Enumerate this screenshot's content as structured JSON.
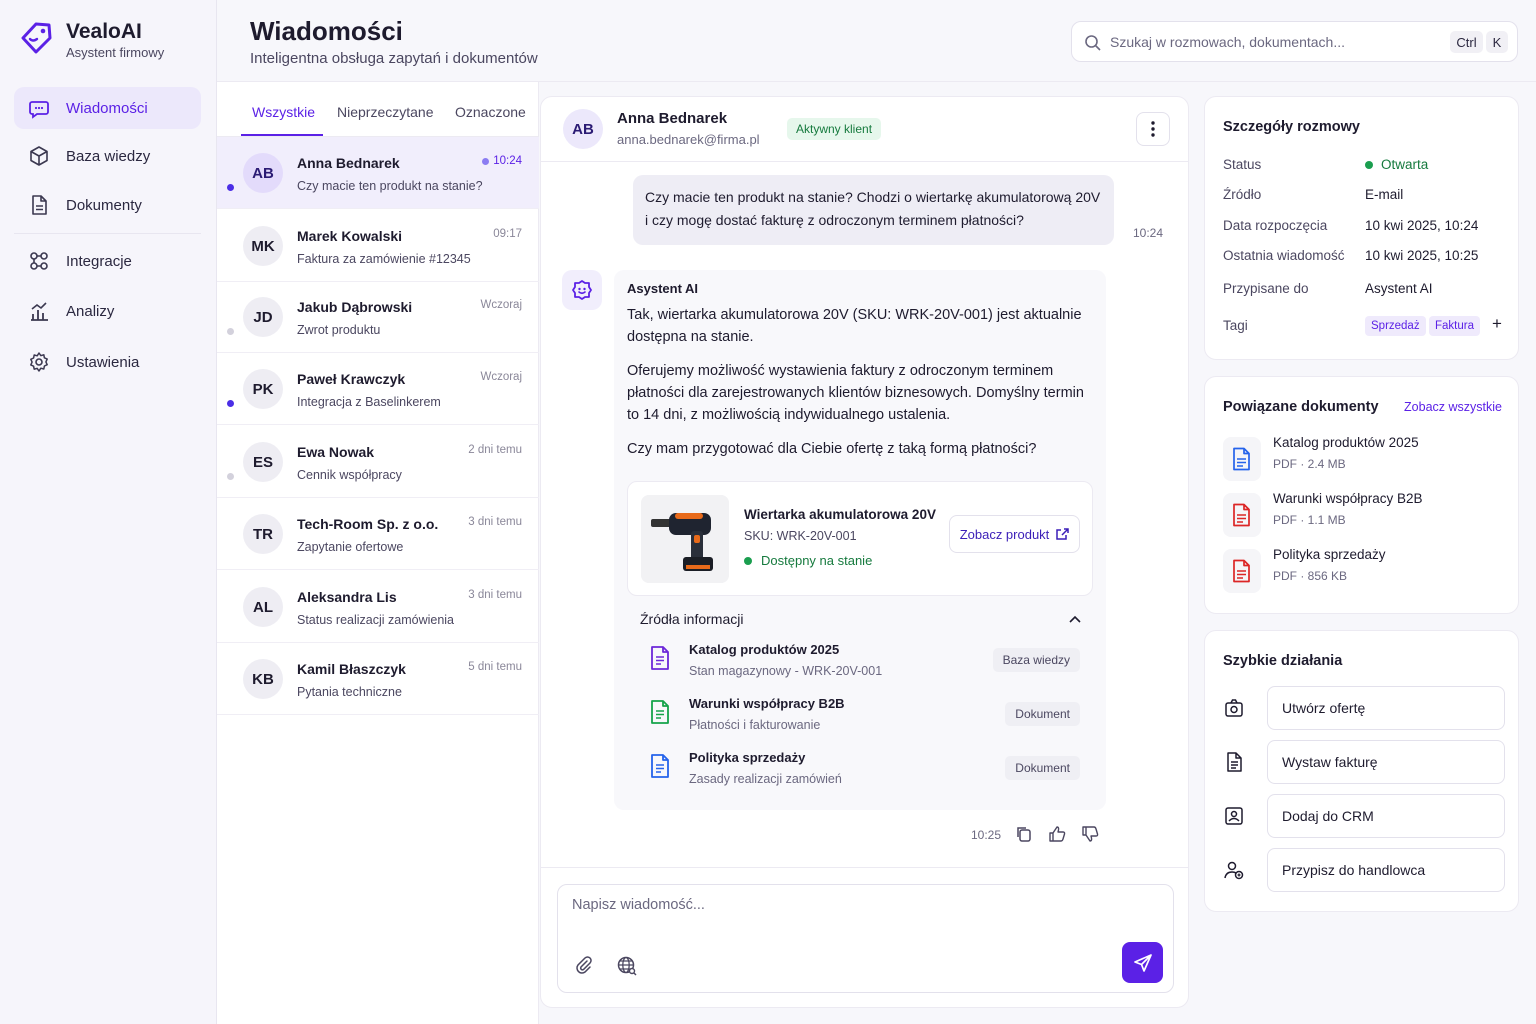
{
  "app": {
    "name": "VealoAI",
    "subtitle": "Asystent firmowy",
    "accent": "#5b21e6"
  },
  "sidebar": {
    "items": [
      {
        "label": "Wiadomości",
        "icon": "chat-icon",
        "active": true
      },
      {
        "label": "Baza wiedzy",
        "icon": "cube-icon"
      },
      {
        "label": "Dokumenty",
        "icon": "document-icon"
      },
      {
        "label": "Integracje",
        "icon": "integrations-icon"
      },
      {
        "label": "Analizy",
        "icon": "analytics-icon"
      },
      {
        "label": "Ustawienia",
        "icon": "gear-icon"
      }
    ]
  },
  "header": {
    "title": "Wiadomości",
    "subtitle": "Inteligentna obsługa zapytań i dokumentów",
    "search_placeholder": "Szukaj w rozmowach, dokumentach...",
    "shortcut_ctrl": "Ctrl",
    "shortcut_key": "K"
  },
  "tabs": [
    "Wszystkie",
    "Nieprzeczytane",
    "Oznaczone"
  ],
  "conversations": [
    {
      "initials": "AB",
      "name": "Anna Bednarek",
      "preview": "Czy macie ten produkt na stanie?",
      "time": "10:24",
      "unread": true,
      "active": true
    },
    {
      "initials": "MK",
      "name": "Marek Kowalski",
      "preview": "Faktura za zamówienie #12345",
      "time": "09:17",
      "unread": false
    },
    {
      "initials": "JD",
      "name": "Jakub Dąbrowski",
      "preview": "Zwrot produktu",
      "time": "Wczoraj",
      "unread": "light"
    },
    {
      "initials": "PK",
      "name": "Paweł Krawczyk",
      "preview": "Integracja z Baselinkerem",
      "time": "Wczoraj",
      "unread": true
    },
    {
      "initials": "ES",
      "name": "Ewa Nowak",
      "preview": "Cennik współpracy",
      "time": "2 dni temu",
      "unread": "light"
    },
    {
      "initials": "TR",
      "name": "Tech-Room Sp. z o.o.",
      "preview": "Zapytanie ofertowe",
      "time": "3 dni temu",
      "unread": false
    },
    {
      "initials": "AL",
      "name": "Aleksandra Lis",
      "preview": "Status realizacji zamówienia",
      "time": "3 dni temu",
      "unread": false
    },
    {
      "initials": "KB",
      "name": "Kamil Błaszczyk",
      "preview": "Pytania techniczne",
      "time": "5 dni temu",
      "unread": false
    }
  ],
  "chat": {
    "contact_initials": "AB",
    "contact_name": "Anna Bednarek",
    "contact_email": "anna.bednarek@firma.pl",
    "contact_badge": "Aktywny klient",
    "user_message_line1": "Czy macie ten produkt na stanie? Chodzi o wiertarkę akumulatorową 20V",
    "user_message_line2": "i czy mogę dostać fakturę z odroczonym terminem płatności?",
    "user_time": "10:24",
    "ai_name": "Asystent AI",
    "ai_p1": "Tak, wiertarka akumulatorowa 20V (SKU: WRK-20V-001) jest aktualnie dostępna na stanie.",
    "ai_p2": "Oferujemy możliwość wystawienia faktury z odroczonym terminem płatności dla zarejestrowanych klientów biznesowych. Domyślny termin to 14 dni, z możliwością indywidualnego ustalenia.",
    "ai_p3": "Czy mam przygotować dla Ciebie ofertę z taką formą płatności?",
    "product": {
      "name": "Wiertarka akumulatorowa 20V",
      "sku": "SKU: WRK-20V-001",
      "stock": "Dostępny na stanie",
      "button": "Zobacz produkt"
    },
    "sources_title": "Źródła informacji",
    "sources": [
      {
        "title": "Katalog produktów 2025",
        "sub": "Stan magazynowy - WRK-20V-001",
        "tag": "Baza wiedzy",
        "color": "#6d28d9"
      },
      {
        "title": "Warunki współpracy B2B",
        "sub": "Płatności i fakturowanie",
        "tag": "Dokument",
        "color": "#16a34a"
      },
      {
        "title": "Polityka sprzedaży",
        "sub": "Zasady realizacji zamówień",
        "tag": "Dokument",
        "color": "#2563eb"
      }
    ],
    "ai_time": "10:25",
    "compose_placeholder": "Napisz wiadomość..."
  },
  "details": {
    "title": "Szczegóły rozmowy",
    "rows": [
      {
        "k": "Status",
        "v": "Otwarta"
      },
      {
        "k": "Źródło",
        "v": "E-mail"
      },
      {
        "k": "Data rozpoczęcia",
        "v": "10 kwi 2025, 10:24"
      },
      {
        "k": "Ostatnia wiadomość",
        "v": "10 kwi 2025, 10:25"
      },
      {
        "k": "Przypisane do",
        "v": "Asystent AI"
      },
      {
        "k": "Tagi",
        "v": ""
      }
    ],
    "tags": [
      "Sprzedaż",
      "Faktura"
    ],
    "add_tag": "+"
  },
  "documents": {
    "title": "Powiązane dokumenty",
    "see_all": "Zobacz wszystkie",
    "items": [
      {
        "name": "Katalog produktów 2025",
        "meta": "PDF · 2.4 MB",
        "color": "#2563eb"
      },
      {
        "name": "Warunki współpracy B2B",
        "meta": "PDF · 1.1 MB",
        "color": "#dc2626"
      },
      {
        "name": "Polityka sprzedaży",
        "meta": "PDF · 856 KB",
        "color": "#dc2626"
      }
    ]
  },
  "quick_actions": {
    "title": "Szybkie działania",
    "items": [
      {
        "label": "Utwórz ofertę",
        "icon": "camera-icon"
      },
      {
        "label": "Wystaw fakturę",
        "icon": "invoice-icon"
      },
      {
        "label": "Dodaj do CRM",
        "icon": "crm-icon"
      },
      {
        "label": "Przypisz do handlowca",
        "icon": "user-assign-icon"
      }
    ]
  }
}
